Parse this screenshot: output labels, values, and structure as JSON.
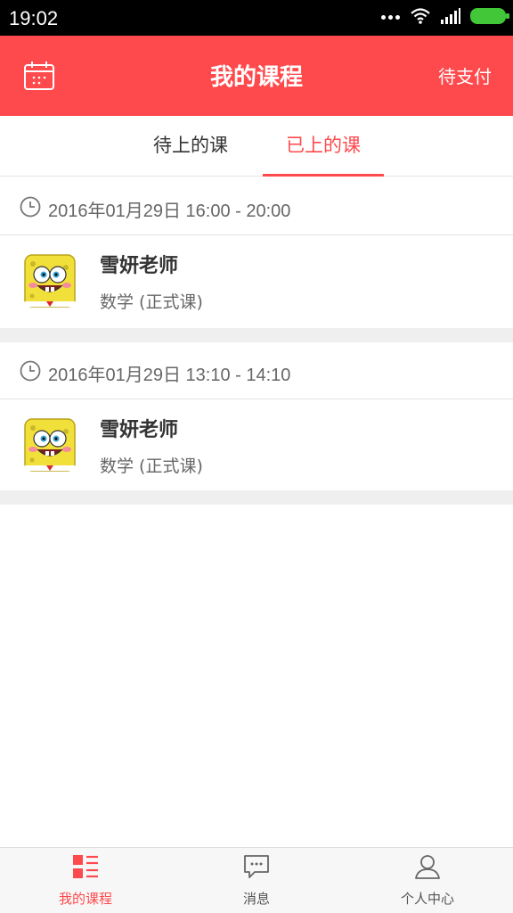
{
  "status_bar": {
    "time": "19:02"
  },
  "header": {
    "title": "我的课程",
    "right_action": "待支付"
  },
  "tabs": [
    {
      "label": "待上的课",
      "active": false
    },
    {
      "label": "已上的课",
      "active": true
    }
  ],
  "courses": [
    {
      "time": "2016年01月29日 16:00 - 20:00",
      "teacher": "雪妍老师",
      "course": "数学 (正式课)"
    },
    {
      "time": "2016年01月29日 13:10 - 14:10",
      "teacher": "雪妍老师",
      "course": "数学 (正式课)"
    }
  ],
  "bottom_nav": [
    {
      "label": "我的课程",
      "icon": "course-list-icon",
      "active": true
    },
    {
      "label": "消息",
      "icon": "message-icon",
      "active": false
    },
    {
      "label": "个人中心",
      "icon": "profile-icon",
      "active": false
    }
  ],
  "colors": {
    "accent": "#ff4a4d",
    "battery": "#41c738"
  }
}
